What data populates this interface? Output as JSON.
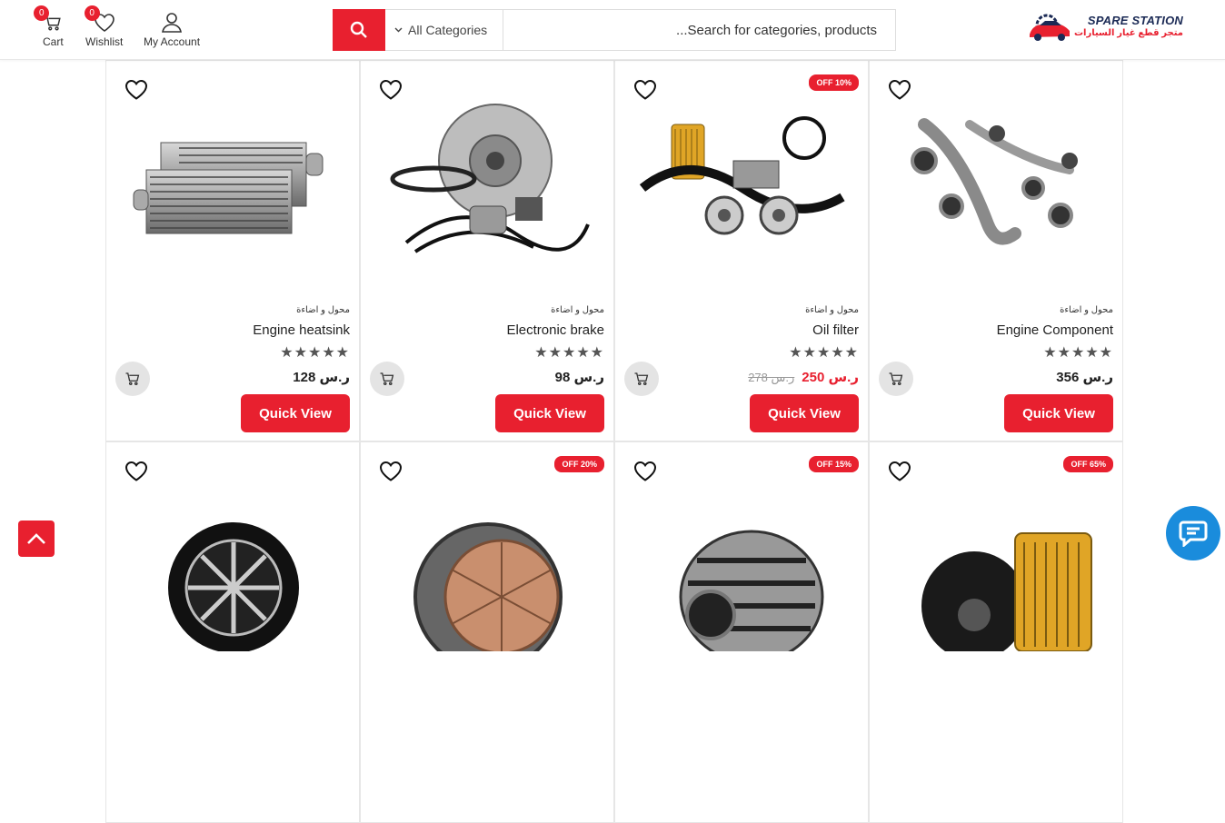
{
  "header": {
    "cart": {
      "label": "Cart",
      "count": "0"
    },
    "wishlist": {
      "label": "Wishlist",
      "count": "0"
    },
    "account": {
      "label": "My Account"
    },
    "search": {
      "category": "All Categories",
      "placeholder": "Search for categories, products..."
    },
    "logo": {
      "title": "SPARE STATION",
      "subtitle": "متجر قطع غيار السيارات"
    }
  },
  "products": [
    {
      "category": "محول و اضاءة",
      "name": "Engine heatsink",
      "price": "128",
      "currency": "ر.س",
      "old_price": "",
      "discount": "",
      "stars": "★★★★★",
      "cta": "Quick View"
    },
    {
      "category": "محول و اضاءة",
      "name": "Electronic brake",
      "price": "98",
      "currency": "ر.س",
      "old_price": "",
      "discount": "",
      "stars": "★★★★★",
      "cta": "Quick View"
    },
    {
      "category": "محول و اضاءة",
      "name": "Oil filter",
      "price": "250",
      "currency": "ر.س",
      "old_price": "278 ر.س",
      "discount": "OFF 10%",
      "stars": "★★★★★",
      "cta": "Quick View"
    },
    {
      "category": "محول و اضاءة",
      "name": "Engine Component",
      "price": "356",
      "currency": "ر.س",
      "old_price": "",
      "discount": "",
      "stars": "★★★★★",
      "cta": "Quick View"
    },
    {
      "discount": ""
    },
    {
      "discount": "OFF 20%"
    },
    {
      "discount": "OFF 15%"
    },
    {
      "discount": "OFF 65%"
    }
  ],
  "colors": {
    "accent": "#e8202f",
    "chat": "#1a8cdc"
  }
}
